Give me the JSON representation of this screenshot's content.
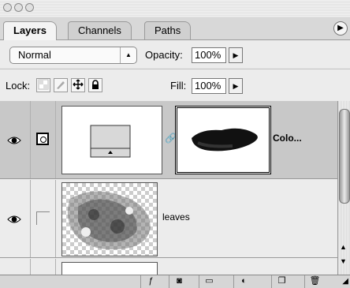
{
  "window": {
    "title": ""
  },
  "tabs": [
    {
      "label": "Layers",
      "active": true
    },
    {
      "label": "Channels",
      "active": false
    },
    {
      "label": "Paths",
      "active": false
    }
  ],
  "blend": {
    "mode": "Normal"
  },
  "opacity": {
    "label": "Opacity:",
    "value": "100%"
  },
  "lock": {
    "label": "Lock:"
  },
  "fill": {
    "label": "Fill:",
    "value": "100%"
  },
  "layers": [
    {
      "name": "Colo...",
      "visible": true,
      "selected": true,
      "type": "adjustment"
    },
    {
      "name": "leaves",
      "visible": true,
      "selected": false,
      "type": "image"
    }
  ],
  "colors": {
    "selected_row": "#c8c8c8",
    "panel": "#ececec"
  }
}
